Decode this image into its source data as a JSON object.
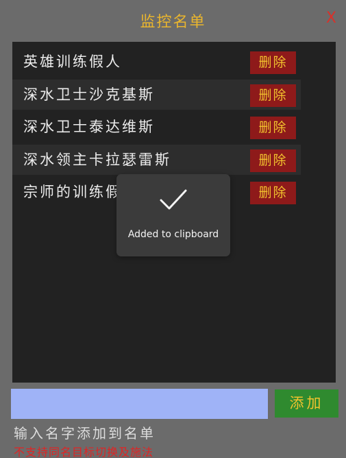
{
  "window": {
    "title": "监控名单",
    "close_label": "X"
  },
  "list": {
    "items": [
      {
        "name": "英雄训练假人",
        "delete_label": "删除"
      },
      {
        "name": "深水卫士沙克基斯",
        "delete_label": "删除"
      },
      {
        "name": "深水卫士泰达维斯",
        "delete_label": "删除"
      },
      {
        "name": "深水领主卡拉瑟雷斯",
        "delete_label": "删除"
      },
      {
        "name": "宗师的训练假人",
        "delete_label": "删除"
      }
    ]
  },
  "toast": {
    "icon": "checkmark-icon",
    "message": "Added to clipboard"
  },
  "input": {
    "value": "",
    "placeholder": ""
  },
  "add_button": {
    "label": "添加"
  },
  "hint": "输入名字添加到名单",
  "warning": "不支持同名目标切换及施法",
  "colors": {
    "background": "#6b6b6b",
    "list_background": "#222222",
    "title": "#e9b52e",
    "close": "#d9312a",
    "delete_button": "#8e1a1a",
    "button_text": "#f2c22e",
    "input_background": "#9fb3f7",
    "add_button": "#2f8a2f",
    "warning": "#e02424"
  }
}
